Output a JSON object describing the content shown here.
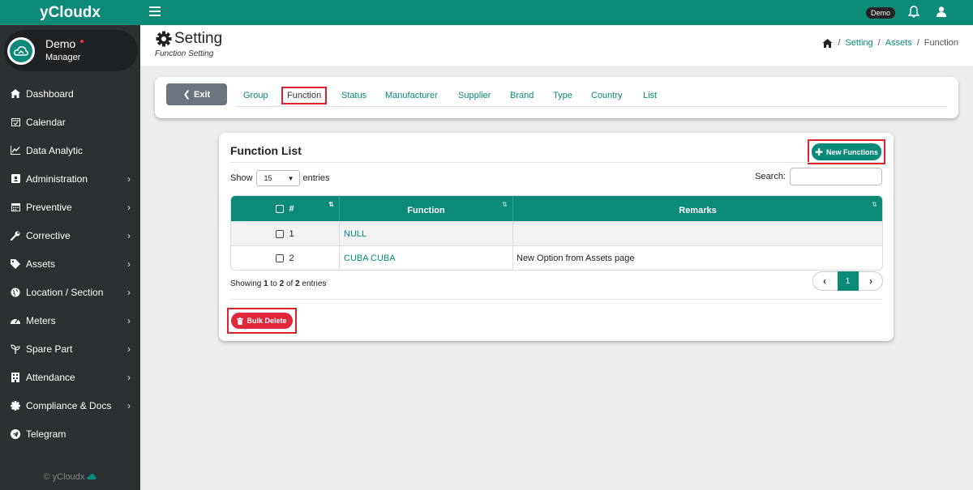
{
  "app": {
    "brand": "yCloudx",
    "footer": "© yCloudx"
  },
  "user": {
    "name": "Demo",
    "role": "Manager"
  },
  "sidebar": {
    "items": [
      {
        "label": "Dashboard",
        "icon": "home-icon",
        "arrow": false
      },
      {
        "label": "Calendar",
        "icon": "calendar-check-icon",
        "arrow": false
      },
      {
        "label": "Data Analytic",
        "icon": "chart-line-icon",
        "arrow": false
      },
      {
        "label": "Administration",
        "icon": "id-card-icon",
        "arrow": true
      },
      {
        "label": "Preventive",
        "icon": "calendar-icon",
        "arrow": true
      },
      {
        "label": "Corrective",
        "icon": "wrench-icon",
        "arrow": true
      },
      {
        "label": "Assets",
        "icon": "tag-icon",
        "arrow": true
      },
      {
        "label": "Location / Section",
        "icon": "globe-icon",
        "arrow": true
      },
      {
        "label": "Meters",
        "icon": "gauge-icon",
        "arrow": true
      },
      {
        "label": "Spare Part",
        "icon": "seedling-icon",
        "arrow": true
      },
      {
        "label": "Attendance",
        "icon": "building-icon",
        "arrow": true
      },
      {
        "label": "Compliance & Docs",
        "icon": "certificate-icon",
        "arrow": true
      },
      {
        "label": "Telegram",
        "icon": "telegram-icon",
        "arrow": false
      }
    ]
  },
  "topbar": {
    "badge": "Demo"
  },
  "header": {
    "title": "Setting",
    "subtitle": "Function Setting",
    "breadcrumb": [
      "Setting",
      "Assets",
      "Function"
    ]
  },
  "tabs": {
    "exit_label": "Exit",
    "items": [
      "Group",
      "Function",
      "Status",
      "Manufacturer",
      "Supplier",
      "Brand",
      "Type",
      "Country",
      "List"
    ],
    "active": "Function"
  },
  "list": {
    "title": "Function List",
    "new_button": "New Functions",
    "show_label": "Show",
    "page_size": "15",
    "entries_label": "entries",
    "search_label": "Search:",
    "columns": [
      "#",
      "Function",
      "Remarks"
    ],
    "rows": [
      {
        "no": "1",
        "function": "NULL",
        "remarks": ""
      },
      {
        "no": "2",
        "function": "CUBA CUBA",
        "remarks": "New Option from Assets page"
      }
    ],
    "info_prefix": "Showing ",
    "info_from": "1",
    "info_mid1": " to ",
    "info_to": "2",
    "info_mid2": " of ",
    "info_total": "2",
    "info_suffix": " entries",
    "page": "1",
    "bulk_delete": "Bulk Delete"
  },
  "colors": {
    "primary": "#0b8a77",
    "danger": "#e0283a",
    "sidebar": "#2b3033"
  }
}
